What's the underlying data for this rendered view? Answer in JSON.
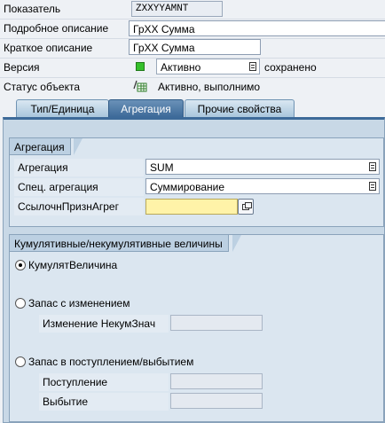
{
  "header": {
    "indicator_label": "Показатель",
    "indicator_value": "ZXXYYAMNT",
    "long_desc_label": "Подробное описание",
    "long_desc_value": "ГрXX Сумма",
    "short_desc_label": "Краткое описание",
    "short_desc_value": "ГрXX Сумма",
    "version_label": "Версия",
    "version_value": "Активно",
    "version_status": "сохранено",
    "object_status_label": "Статус объекта",
    "object_status_value": "Активно, выполнимо"
  },
  "tabs": [
    {
      "label": "Тип/Единица",
      "active": false
    },
    {
      "label": "Агрегация",
      "active": true
    },
    {
      "label": "Прочие свойства",
      "active": false
    }
  ],
  "aggregation_group": {
    "title": "Агрегация",
    "aggregation_label": "Агрегация",
    "aggregation_value": "SUM",
    "exception_label": "Спец. агрегация",
    "exception_value": "Суммирование",
    "ref_char_label": "СсылочнПризнАгрег",
    "ref_char_value": ""
  },
  "cumulative_group": {
    "title": "Кумулятивные/некумулятивные величины",
    "opt_cumulative": "КумулятВеличина",
    "opt_change": "Запас с изменением",
    "change_label": "Изменение НекумЗнач",
    "change_value": "",
    "opt_inflow_outflow": "Запас в поступлением/выбытием",
    "inflow_label": "Поступление",
    "inflow_value": "",
    "outflow_label": "Выбытие",
    "outflow_value": "",
    "selected": "cumulative"
  },
  "colors": {
    "tab_active": "#3d6a99",
    "status_green": "#35c02b",
    "required_field": "#fff3a8"
  },
  "icons": {
    "version_status": "green-square-icon",
    "object_status": "activated-object-icon",
    "dropdown": "dropdown-list-icon",
    "value_help": "value-help-icon"
  }
}
